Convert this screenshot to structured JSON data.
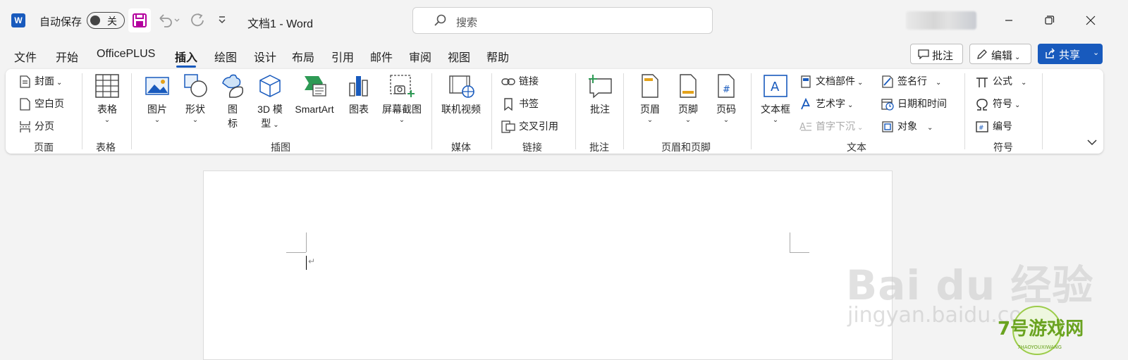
{
  "titlebar": {
    "autosave_label": "自动保存",
    "toggle_state": "关",
    "doc_title": "文档1  -  Word",
    "search_placeholder": "搜索"
  },
  "tabs": [
    "文件",
    "开始",
    "OfficePLUS",
    "插入",
    "绘图",
    "设计",
    "布局",
    "引用",
    "邮件",
    "审阅",
    "视图",
    "帮助"
  ],
  "active_tab": "插入",
  "actions": {
    "comment": "批注",
    "edit": "编辑",
    "share": "共享"
  },
  "ribbon": {
    "pages": {
      "cover": "封面",
      "blank": "空白页",
      "break": "分页",
      "group": "页面"
    },
    "tables": {
      "table": "表格",
      "group": "表格"
    },
    "illustrations": {
      "picture": "图片",
      "shapes": "形状",
      "icons_1": "图",
      "icons_2": "标",
      "model3d_1": "3D 模",
      "model3d_2": "型",
      "smartart": "SmartArt",
      "chart": "图表",
      "screenshot": "屏幕截图",
      "group": "插图"
    },
    "media": {
      "video": "联机视频",
      "group": "媒体"
    },
    "links": {
      "link": "链接",
      "bookmark": "书签",
      "crossref": "交叉引用",
      "group": "链接"
    },
    "comments": {
      "comment": "批注",
      "group": "批注"
    },
    "header_footer": {
      "header": "页眉",
      "footer": "页脚",
      "page_number": "页码",
      "group": "页眉和页脚"
    },
    "text": {
      "textbox": "文本框",
      "quick_parts": "文档部件",
      "wordart": "艺术字",
      "dropcap": "首字下沉",
      "signature": "签名行",
      "datetime": "日期和时间",
      "object": "对象",
      "group": "文本"
    },
    "symbols": {
      "equation": "公式",
      "symbol": "符号",
      "number": "编号",
      "group": "符号"
    }
  },
  "document": {
    "paragraph_mark": "↵"
  },
  "watermark": {
    "baidu": "Bai du 经验",
    "url": "jingyan.baidu.com",
    "site_logo": "7号游戏网",
    "site_logo_small": "7HAOYOUXIWANG"
  },
  "colors": {
    "accent": "#185abd",
    "save_icon": "#b4009e"
  }
}
